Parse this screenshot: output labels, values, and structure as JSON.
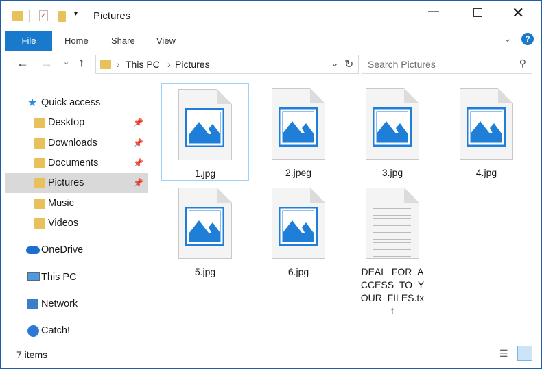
{
  "window": {
    "title": "Pictures"
  },
  "ribbon": {
    "tabs": [
      "File",
      "Home",
      "Share",
      "View"
    ]
  },
  "address": {
    "path": [
      "This PC",
      "Pictures"
    ]
  },
  "search": {
    "placeholder": "Search Pictures"
  },
  "nav": {
    "items": [
      {
        "label": "Quick access",
        "icon": "star-icon"
      },
      {
        "label": "Desktop",
        "icon": "folder-icon",
        "pinned": true
      },
      {
        "label": "Downloads",
        "icon": "downloads-folder-icon",
        "pinned": true
      },
      {
        "label": "Documents",
        "icon": "documents-folder-icon",
        "pinned": true
      },
      {
        "label": "Pictures",
        "icon": "pictures-folder-icon",
        "pinned": true,
        "selected": true
      },
      {
        "label": "Music",
        "icon": "music-folder-icon"
      },
      {
        "label": "Videos",
        "icon": "videos-folder-icon"
      },
      {
        "label": "OneDrive",
        "icon": "cloud-icon"
      },
      {
        "label": "This PC",
        "icon": "computer-icon"
      },
      {
        "label": "Network",
        "icon": "network-icon"
      },
      {
        "label": "Catch!",
        "icon": "catch-icon"
      }
    ]
  },
  "files": [
    {
      "name": "1.jpg",
      "type": "image"
    },
    {
      "name": "2.jpeg",
      "type": "image"
    },
    {
      "name": "3.jpg",
      "type": "image"
    },
    {
      "name": "4.jpg",
      "type": "image"
    },
    {
      "name": "5.jpg",
      "type": "image"
    },
    {
      "name": "6.jpg",
      "type": "image"
    },
    {
      "name": "DEAL_FOR_ACCESS_TO_YOUR_FILES.txt",
      "type": "text"
    }
  ],
  "status": {
    "count": "7 items"
  },
  "colors": {
    "accent": "#1979ca",
    "frame": "#1e5fa8",
    "image_icon": "#1f7fd8"
  }
}
